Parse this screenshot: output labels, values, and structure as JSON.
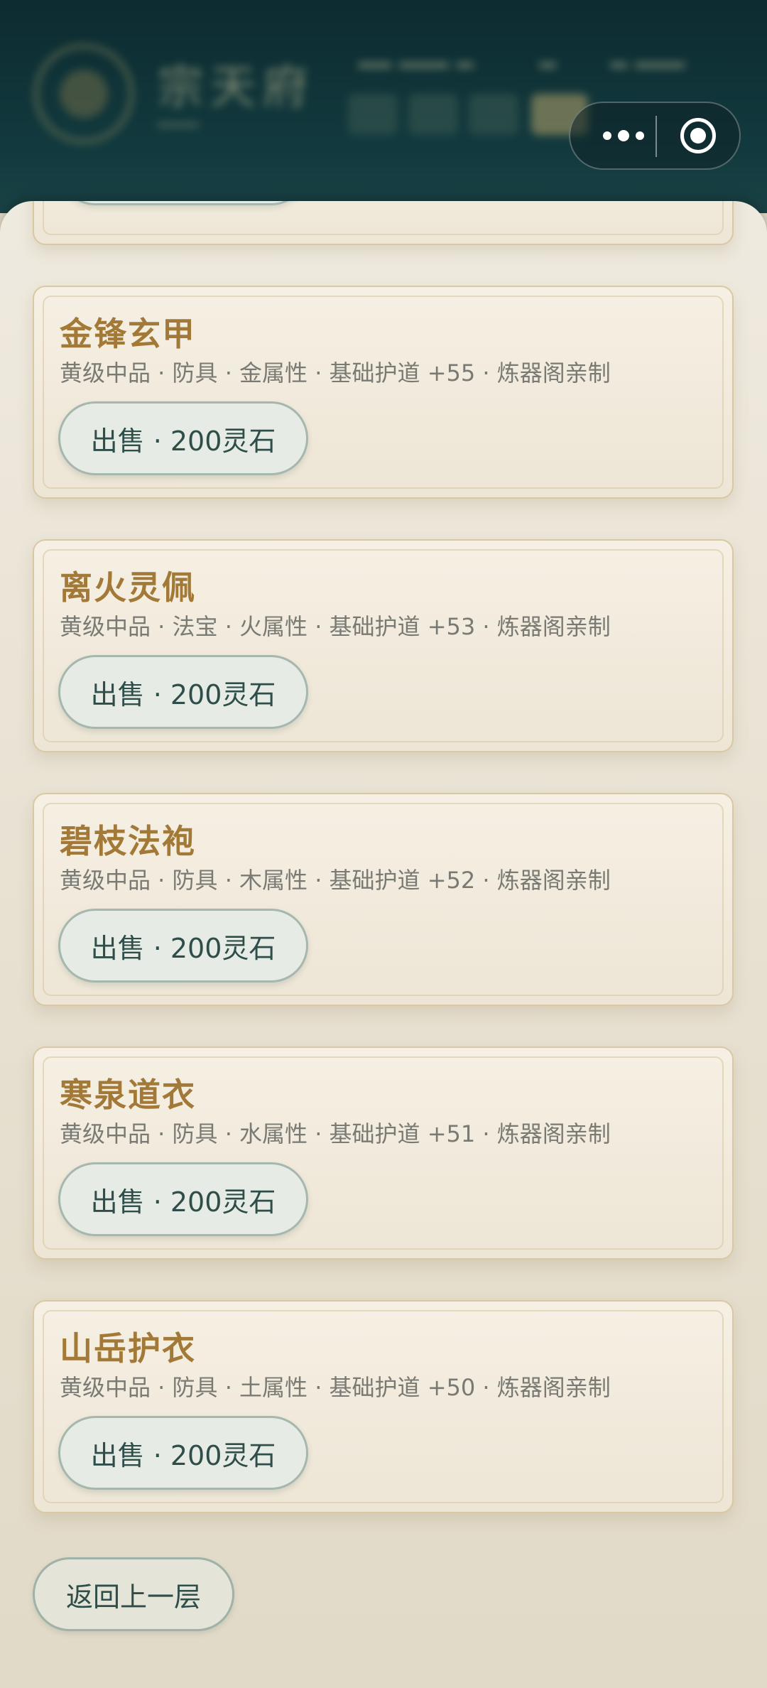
{
  "capsule": {
    "more_icon": "more-dots-icon",
    "close_icon": "target-close-icon"
  },
  "items": [
    {
      "name": "金锋玄甲",
      "desc": "黄级中品 · 防具 · 金属性 · 基础护道 +55 · 炼器阁亲制",
      "sell_label": "出售 · 200灵石"
    },
    {
      "name": "离火灵佩",
      "desc": "黄级中品 · 法宝 · 火属性 · 基础护道 +53 · 炼器阁亲制",
      "sell_label": "出售 · 200灵石"
    },
    {
      "name": "碧枝法袍",
      "desc": "黄级中品 · 防具 · 木属性 · 基础护道 +52 · 炼器阁亲制",
      "sell_label": "出售 · 200灵石"
    },
    {
      "name": "寒泉道衣",
      "desc": "黄级中品 · 防具 · 水属性 · 基础护道 +51 · 炼器阁亲制",
      "sell_label": "出售 · 200灵石"
    },
    {
      "name": "山岳护衣",
      "desc": "黄级中品 · 防具 · 土属性 · 基础护道 +50 · 炼器阁亲制",
      "sell_label": "出售 · 200灵石"
    }
  ],
  "back_label": "返回上一层"
}
